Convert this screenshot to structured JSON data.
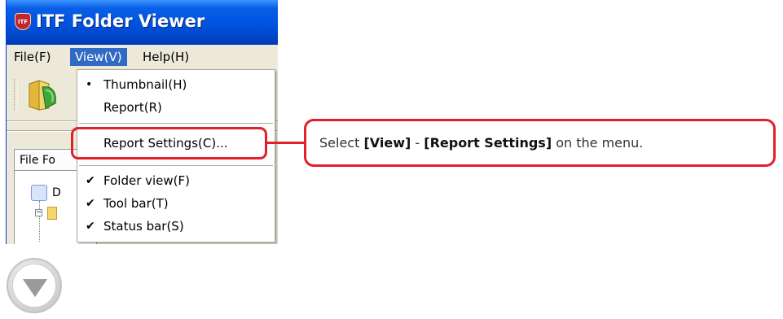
{
  "window": {
    "title": "ITF Folder Viewer",
    "icon_label": "ITF"
  },
  "menubar": {
    "items": [
      {
        "label": "File(F)"
      },
      {
        "label": "View(V)"
      },
      {
        "label": "Help(H)"
      }
    ]
  },
  "left_panel": {
    "tab_label": "File Fo",
    "tree_root_label": "D"
  },
  "view_menu": {
    "items": [
      {
        "label": "Thumbnail(H)",
        "mark": "•"
      },
      {
        "label": "Report(R)",
        "mark": ""
      },
      {
        "label": "Report Settings(C)...",
        "mark": ""
      },
      {
        "label": "Folder view(F)",
        "mark": "✔"
      },
      {
        "label": "Tool bar(T)",
        "mark": "✔"
      },
      {
        "label": "Status bar(S)",
        "mark": "✔"
      }
    ]
  },
  "callout": {
    "prefix": "Select ",
    "bold1": "[View]",
    "middle": " - ",
    "bold2": "[Report Settings]",
    "suffix": " on the menu."
  },
  "next_button": {
    "icon": "down-triangle-icon"
  },
  "colors": {
    "titlebar": "#0054e3",
    "menu_highlight": "#316ac5",
    "callout_border": "#e0202a"
  }
}
